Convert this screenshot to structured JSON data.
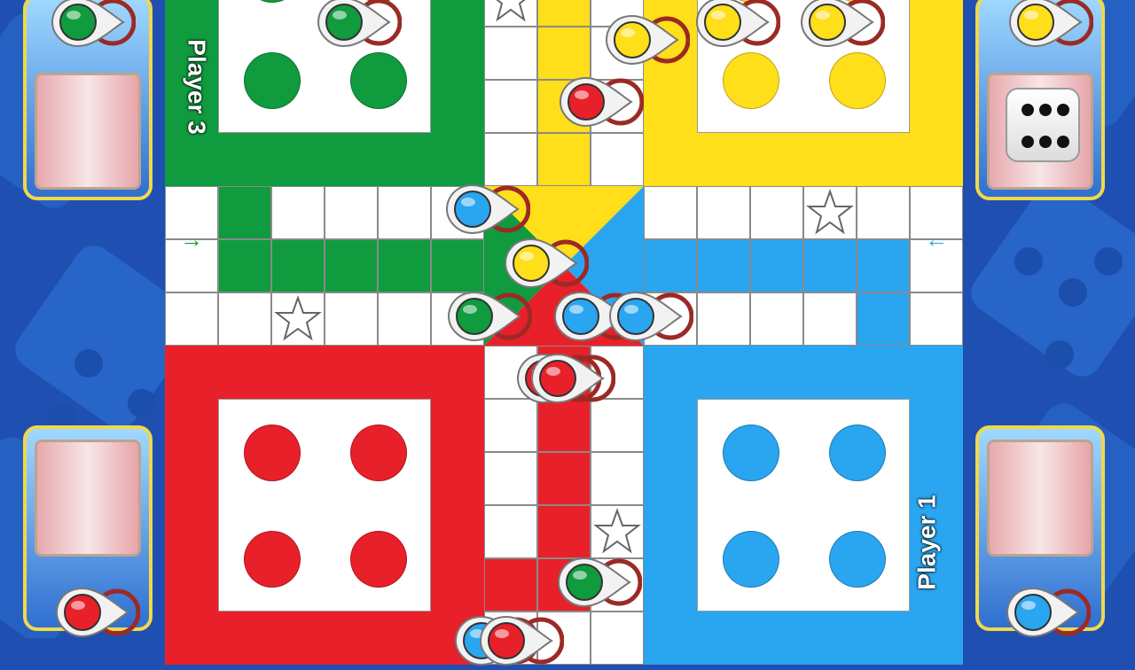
{
  "colors": {
    "green": "#0f9b3e",
    "yellow": "#ffde1a",
    "red": "#e8202a",
    "blue": "#2aa5f0",
    "board_bg": "#1f4fb0"
  },
  "players": {
    "player3_label": "Player 3",
    "player1_label": "Player 1"
  },
  "board": {
    "arrow_left_glyph": "→",
    "arrow_right_glyph": "←"
  },
  "panels": {
    "top_left": {
      "token_color": "green",
      "active": false
    },
    "top_right": {
      "token_color": "yellow",
      "active": true,
      "dice_value": 6
    },
    "bottom_left": {
      "token_color": "red",
      "active": false
    },
    "bottom_right": {
      "token_color": "blue",
      "active": false
    }
  },
  "tokens": [
    {
      "color": "green",
      "area": "green-home"
    },
    {
      "color": "yellow",
      "area": "yellow-home"
    },
    {
      "color": "yellow",
      "area": "yellow-home"
    },
    {
      "color": "yellow",
      "area": "track"
    },
    {
      "color": "red",
      "area": "track"
    },
    {
      "color": "blue",
      "area": "track"
    },
    {
      "color": "yellow",
      "area": "finish"
    },
    {
      "color": "green",
      "area": "finish"
    },
    {
      "color": "blue",
      "area": "finish"
    },
    {
      "color": "blue",
      "area": "finish"
    },
    {
      "color": "red",
      "area": "finish"
    },
    {
      "color": "red",
      "area": "finish"
    },
    {
      "color": "green",
      "area": "track"
    },
    {
      "color": "blue",
      "area": "track"
    },
    {
      "color": "red",
      "area": "track"
    }
  ],
  "icons": {
    "star": "safe-star-icon",
    "dice": "dice-icon",
    "token": "pawn-token-icon"
  }
}
